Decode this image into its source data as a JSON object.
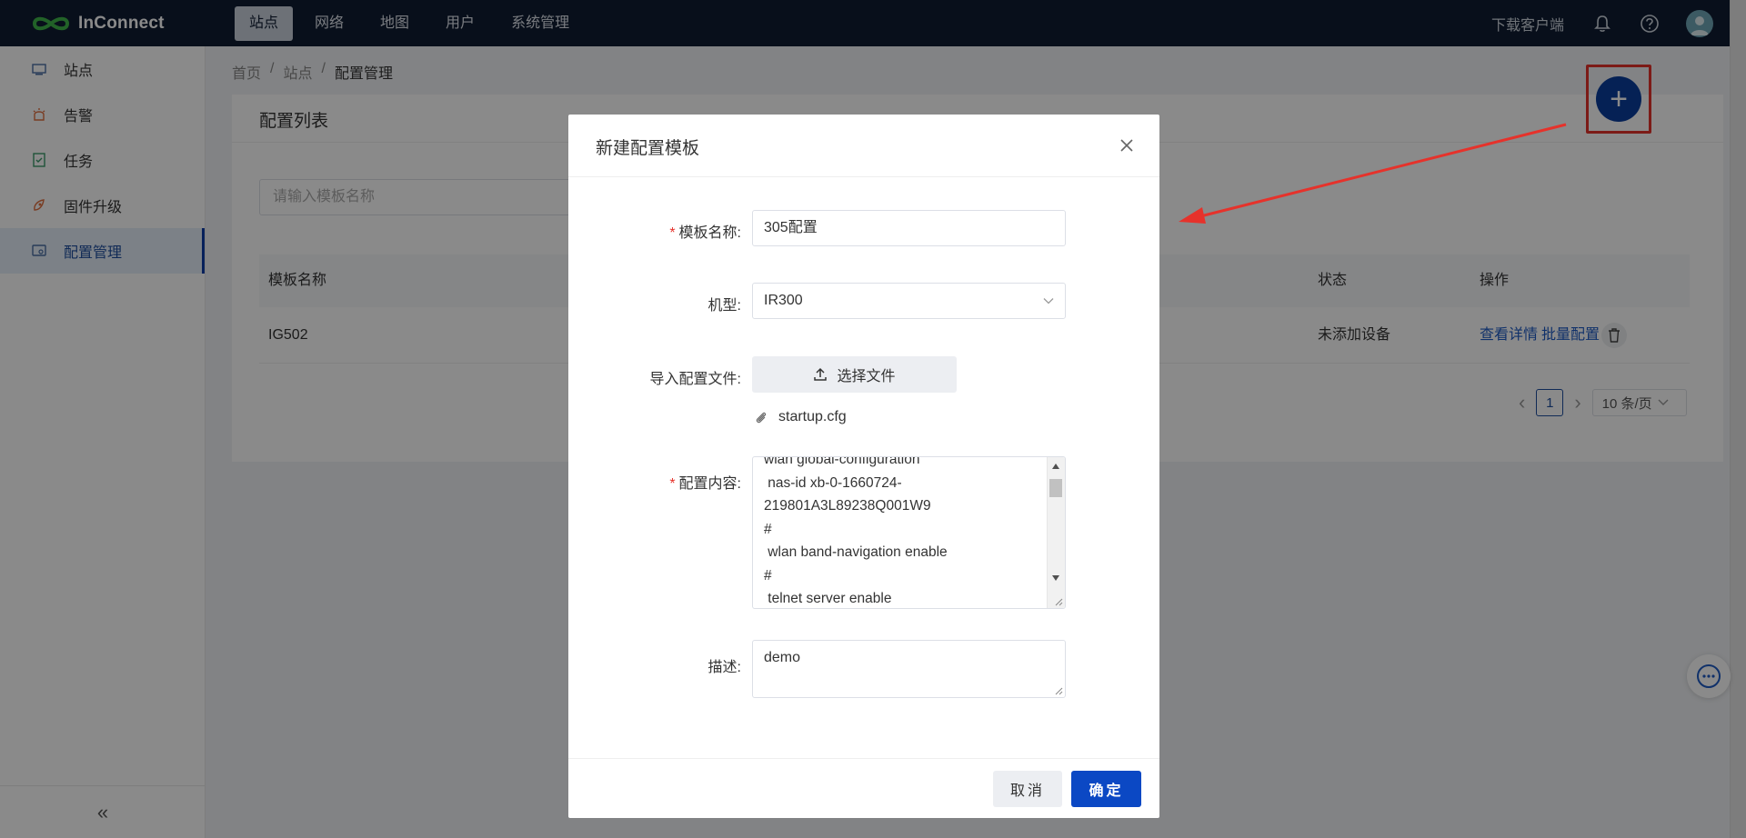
{
  "app": {
    "name": "InConnect"
  },
  "topnav": {
    "items": [
      "站点",
      "网络",
      "地图",
      "用户",
      "系统管理"
    ],
    "active": 0,
    "download_client": "下载客户端"
  },
  "sidebar": {
    "items": [
      {
        "label": "站点",
        "icon": "site-icon"
      },
      {
        "label": "告警",
        "icon": "alarm-icon"
      },
      {
        "label": "任务",
        "icon": "task-icon"
      },
      {
        "label": "固件升级",
        "icon": "firmware-icon"
      },
      {
        "label": "配置管理",
        "icon": "config-icon"
      }
    ],
    "active": 4,
    "collapse": "«"
  },
  "breadcrumb": [
    "首页",
    "站点",
    "配置管理"
  ],
  "breadcrumb_sep": "/",
  "panel": {
    "title": "配置列表",
    "search_placeholder": "请输入模板名称",
    "columns": {
      "name": "模板名称",
      "status": "状态",
      "actions": "操作"
    },
    "rows": [
      {
        "name": "IG502",
        "status": "未添加设备",
        "view": "查看详情",
        "batch": "批量配置"
      }
    ],
    "pager": {
      "prev": "‹",
      "page": "1",
      "next": "›",
      "size": "10 条/页"
    }
  },
  "fab": {
    "label": "+"
  },
  "modal": {
    "title": "新建配置模板",
    "fields": {
      "name_label": "模板名称:",
      "name_value": "305配置",
      "model_label": "机型:",
      "model_value": "IR300",
      "import_label": "导入配置文件:",
      "upload_button": "选择文件",
      "file_name": "startup.cfg",
      "content_label": "配置内容:",
      "content_lines": [
        "wlan global-configuration",
        " nas-id xb-0-1660724-",
        "219801A3L89238Q001W9",
        "#",
        " wlan band-navigation enable",
        "#",
        " telnet server enable"
      ],
      "desc_label": "描述:",
      "desc_value": "demo"
    },
    "cancel": "取消",
    "ok": "确定"
  },
  "colors": {
    "topbar": "#0f1d32",
    "primary": "#0b48c4",
    "annotation_red": "#e6322b"
  }
}
